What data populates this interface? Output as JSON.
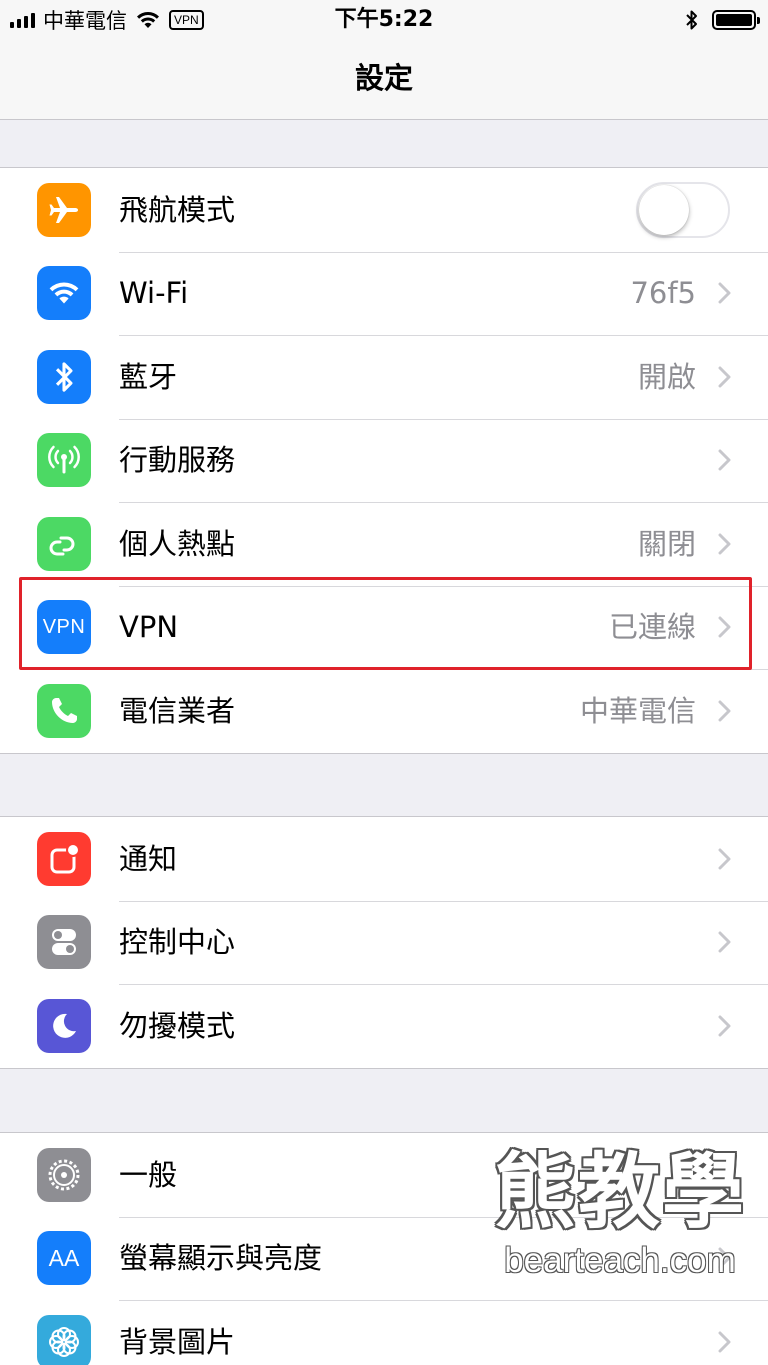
{
  "status_bar": {
    "carrier": "中華電信",
    "vpn_badge": "VPN",
    "time": "下午5:22",
    "icons": [
      "signal-icon",
      "wifi-icon",
      "bluetooth-icon",
      "battery-icon"
    ]
  },
  "nav": {
    "title": "設定"
  },
  "colors": {
    "orange": "#ff9500",
    "blue": "#147efb",
    "green": "#4cd964",
    "red": "#ff3b30",
    "gray": "#8e8e93",
    "purple": "#5856d6",
    "highlight_red": "#e0222a",
    "separator": "#c8c7cc"
  },
  "groups": [
    {
      "rows": [
        {
          "label": "飛航模式",
          "icon": "airplane-icon",
          "color": "#ff9500",
          "toggle_on": false
        },
        {
          "label": "Wi-Fi",
          "value": "76f5",
          "icon": "wifi-icon",
          "color": "#147efb"
        },
        {
          "label": "藍牙",
          "value": "開啟",
          "icon": "bluetooth-icon",
          "color": "#147efb"
        },
        {
          "label": "行動服務",
          "value": "",
          "icon": "antenna-icon",
          "color": "#4cd964"
        },
        {
          "label": "個人熱點",
          "value": "關閉",
          "icon": "hotspot-icon",
          "color": "#4cd964"
        },
        {
          "label": "VPN",
          "value": "已連線",
          "icon": "vpn-icon",
          "icon_text": "VPN",
          "color": "#147efb"
        },
        {
          "label": "電信業者",
          "value": "中華電信",
          "icon": "phone-icon",
          "color": "#4cd964"
        }
      ]
    },
    {
      "rows": [
        {
          "label": "通知",
          "icon": "notifications-icon",
          "color": "#ff3b30"
        },
        {
          "label": "控制中心",
          "icon": "control-center-icon",
          "color": "#8e8e93"
        },
        {
          "label": "勿擾模式",
          "icon": "moon-icon",
          "color": "#5856d6"
        }
      ]
    },
    {
      "rows": [
        {
          "label": "一般",
          "icon": "gear-icon",
          "color": "#8e8e93"
        },
        {
          "label": "螢幕顯示與亮度",
          "icon": "display-icon",
          "icon_text": "AA",
          "color": "#147efb"
        },
        {
          "label": "背景圖片",
          "icon": "wallpaper-icon",
          "color": "#34aadc"
        }
      ]
    }
  ],
  "watermark": {
    "title": "熊教學",
    "url": "bearteach.com"
  }
}
